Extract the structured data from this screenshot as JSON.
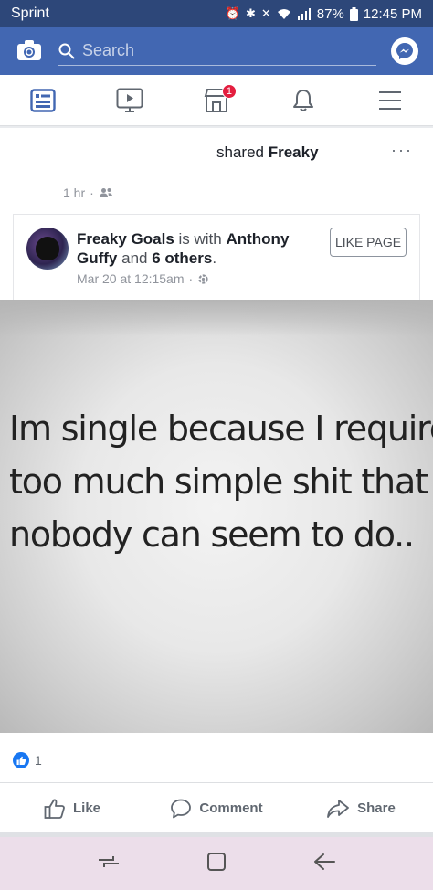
{
  "status": {
    "carrier": "Sprint",
    "battery": "87%",
    "time": "12:45 PM"
  },
  "header": {
    "search_placeholder": "Search"
  },
  "tabs": {
    "notifications_badge": "1"
  },
  "post": {
    "shared_prefix": "shared ",
    "shared_name": "Freaky",
    "time": "1 hr",
    "page_name": "Freaky Goals",
    "with_text": " is with ",
    "tagged_name": "Anthony Guffy",
    "and_text": " and ",
    "others_text": "6 others",
    "period": ".",
    "date": "Mar 20 at 12:15am",
    "like_page_label": "LIKE PAGE",
    "quote_line1": "Im single because I require",
    "quote_line2": "too much simple shit that",
    "quote_line3": "nobody can seem to do..",
    "reaction_count": "1"
  },
  "actions": {
    "like": "Like",
    "comment": "Comment",
    "share": "Share"
  },
  "colors": {
    "brand": "#4267b2",
    "status_bar": "#2d4779",
    "badge": "#e41e3f",
    "nav_bar": "#ecdeea"
  }
}
